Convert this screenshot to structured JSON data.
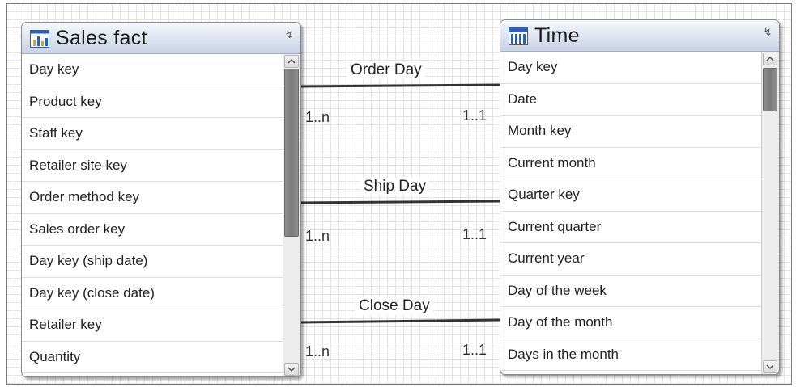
{
  "tables": {
    "sales_fact": {
      "title": "Sales fact",
      "icon": "fact-table-icon",
      "fields": [
        "Day key",
        "Product key",
        "Staff key",
        "Retailer site key",
        "Order method key",
        "Sales order key",
        "Day key (ship date)",
        "Day key (close date)",
        "Retailer key",
        "Quantity"
      ]
    },
    "time": {
      "title": "Time",
      "icon": "dimension-table-icon",
      "fields": [
        "Day key",
        "Date",
        "Month key",
        "Current month",
        "Quarter key",
        "Current quarter",
        "Current year",
        "Day of the week",
        "Day of the month",
        "Days in the month"
      ]
    }
  },
  "relationships": [
    {
      "name": "Order Day",
      "left_cardinality": "1..n",
      "right_cardinality": "1..1"
    },
    {
      "name": "Ship Day",
      "left_cardinality": "1..n",
      "right_cardinality": "1..1"
    },
    {
      "name": "Close Day",
      "left_cardinality": "1..n",
      "right_cardinality": "1..1"
    }
  ],
  "colors": {
    "header_gradient_top": "#f5f7fb",
    "header_gradient_bottom": "#c9d3e6",
    "grid": "#e3e3e3",
    "join_line": "#333333",
    "icon_accent": "#2f5fb0"
  }
}
